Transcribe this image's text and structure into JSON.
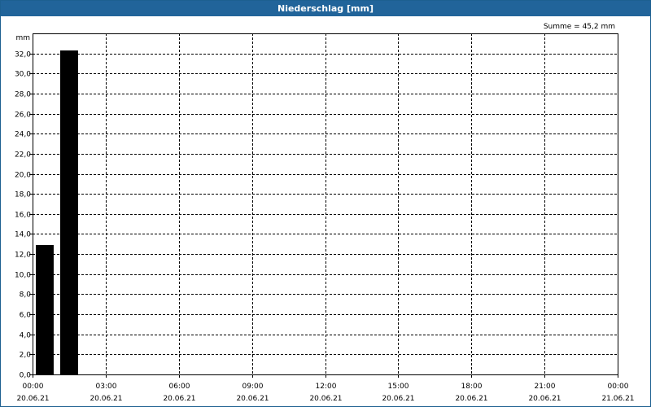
{
  "window": {
    "title": "Niederschlag [mm]"
  },
  "chart_data": {
    "type": "bar",
    "title": "Niederschlag [mm]",
    "ylabel": "mm",
    "ylim": [
      0,
      34
    ],
    "y_ticks": [
      0,
      2,
      4,
      6,
      8,
      10,
      12,
      14,
      16,
      18,
      20,
      22,
      24,
      26,
      28,
      30,
      32
    ],
    "y_tick_labels": [
      "0,0",
      "2,0",
      "4,0",
      "6,0",
      "8,0",
      "10,0",
      "12,0",
      "14,0",
      "16,0",
      "18,0",
      "20,0",
      "22,0",
      "24,0",
      "26,0",
      "28,0",
      "30,0",
      "32,0"
    ],
    "x_range_hours": [
      0,
      24
    ],
    "x_ticks": [
      {
        "hour": 0,
        "time": "00:00",
        "date": "20.06.21"
      },
      {
        "hour": 3,
        "time": "03:00",
        "date": "20.06.21"
      },
      {
        "hour": 6,
        "time": "06:00",
        "date": "20.06.21"
      },
      {
        "hour": 9,
        "time": "09:00",
        "date": "20.06.21"
      },
      {
        "hour": 12,
        "time": "12:00",
        "date": "20.06.21"
      },
      {
        "hour": 15,
        "time": "15:00",
        "date": "20.06.21"
      },
      {
        "hour": 18,
        "time": "18:00",
        "date": "20.06.21"
      },
      {
        "hour": 21,
        "time": "21:00",
        "date": "20.06.21"
      },
      {
        "hour": 24,
        "time": "00:00",
        "date": "21.06.21"
      }
    ],
    "bars": [
      {
        "start_hour": 0,
        "end_hour": 1,
        "value": 12.9
      },
      {
        "start_hour": 1,
        "end_hour": 2,
        "value": 32.3
      }
    ],
    "annotation": "Summe = 45,2 mm",
    "grid": true,
    "bar_color": "#000000"
  }
}
